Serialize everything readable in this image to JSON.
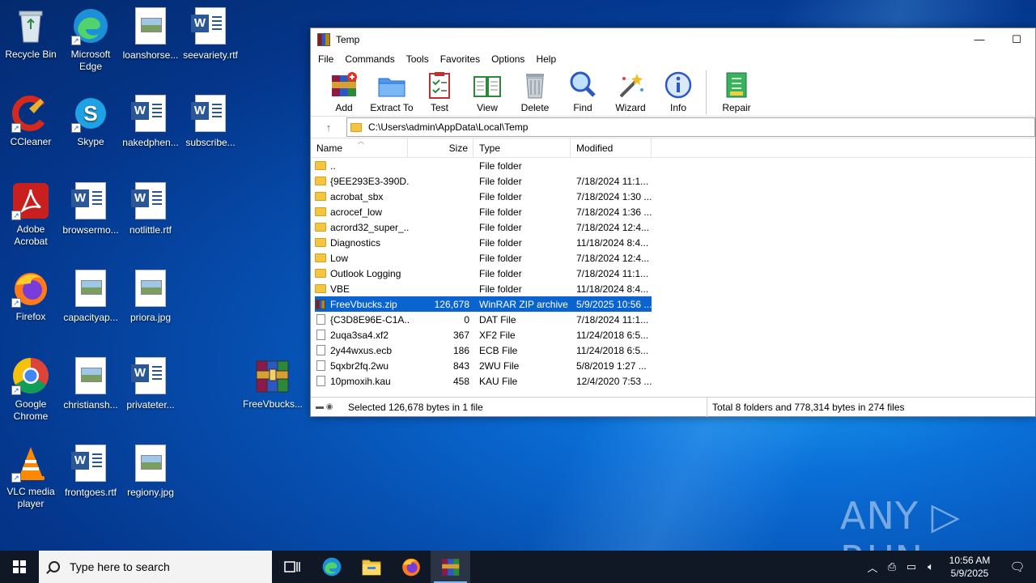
{
  "desktop": {
    "icons": [
      {
        "label": "Recycle Bin"
      },
      {
        "label": "Microsoft Edge"
      },
      {
        "label": "loanshorse..."
      },
      {
        "label": "seevariety.rtf"
      },
      {
        "label": "CCleaner"
      },
      {
        "label": "Skype"
      },
      {
        "label": "nakedphen..."
      },
      {
        "label": "subscribe..."
      },
      {
        "label": "Adobe Acrobat"
      },
      {
        "label": "browsermo..."
      },
      {
        "label": "notlittle.rtf"
      },
      {
        "label": "Firefox"
      },
      {
        "label": "capacityap..."
      },
      {
        "label": "priora.jpg"
      },
      {
        "label": "Google Chrome"
      },
      {
        "label": "christiansh..."
      },
      {
        "label": "privateter..."
      },
      {
        "label": "FreeVbucks..."
      },
      {
        "label": "VLC media player"
      },
      {
        "label": "frontgoes.rtf"
      },
      {
        "label": "regiony.jpg"
      }
    ]
  },
  "window": {
    "title": "Temp",
    "minimize": "—",
    "maximize": "☐",
    "menu": [
      "File",
      "Commands",
      "Tools",
      "Favorites",
      "Options",
      "Help"
    ],
    "toolbar": [
      "Add",
      "Extract To",
      "Test",
      "View",
      "Delete",
      "Find",
      "Wizard",
      "Info",
      "Repair"
    ],
    "address": "C:\\Users\\admin\\AppData\\Local\\Temp",
    "columns": {
      "name": "Name",
      "size": "Size",
      "type": "Type",
      "modified": "Modified"
    },
    "rows": [
      {
        "name": "..",
        "size": "",
        "type": "File folder",
        "modified": "",
        "kind": "folder"
      },
      {
        "name": "{9EE293E3-390D...",
        "size": "",
        "type": "File folder",
        "modified": "7/18/2024 11:1...",
        "kind": "folder"
      },
      {
        "name": "acrobat_sbx",
        "size": "",
        "type": "File folder",
        "modified": "7/18/2024 1:30 ...",
        "kind": "folder"
      },
      {
        "name": "acrocef_low",
        "size": "",
        "type": "File folder",
        "modified": "7/18/2024 1:36 ...",
        "kind": "folder"
      },
      {
        "name": "acrord32_super_...",
        "size": "",
        "type": "File folder",
        "modified": "7/18/2024 12:4...",
        "kind": "folder"
      },
      {
        "name": "Diagnostics",
        "size": "",
        "type": "File folder",
        "modified": "11/18/2024 8:4...",
        "kind": "folder"
      },
      {
        "name": "Low",
        "size": "",
        "type": "File folder",
        "modified": "7/18/2024 12:4...",
        "kind": "folder"
      },
      {
        "name": "Outlook Logging",
        "size": "",
        "type": "File folder",
        "modified": "7/18/2024 11:1...",
        "kind": "folder"
      },
      {
        "name": "VBE",
        "size": "",
        "type": "File folder",
        "modified": "11/18/2024 8:4...",
        "kind": "folder"
      },
      {
        "name": "FreeVbucks.zip",
        "size": "126,678",
        "type": "WinRAR ZIP archive",
        "modified": "5/9/2025 10:56 ...",
        "kind": "zip",
        "selected": true
      },
      {
        "name": "{C3D8E96E-C1A...",
        "size": "0",
        "type": "DAT File",
        "modified": "7/18/2024 11:1...",
        "kind": "file"
      },
      {
        "name": "2uqa3sa4.xf2",
        "size": "367",
        "type": "XF2 File",
        "modified": "11/24/2018 6:5...",
        "kind": "file"
      },
      {
        "name": "2y44wxus.ecb",
        "size": "186",
        "type": "ECB File",
        "modified": "11/24/2018 6:5...",
        "kind": "file"
      },
      {
        "name": "5qxbr2fq.2wu",
        "size": "843",
        "type": "2WU File",
        "modified": "5/8/2019 1:27 ...",
        "kind": "file"
      },
      {
        "name": "10pmoxih.kau",
        "size": "458",
        "type": "KAU File",
        "modified": "12/4/2020 7:53 ...",
        "kind": "file"
      }
    ],
    "status_left": "Selected 126,678 bytes in 1 file",
    "status_right": "Total 8 folders and 778,314 bytes in 274 files"
  },
  "watermark": "ANY ▷ RUN",
  "taskbar": {
    "search_placeholder": "Type here to search",
    "time": "10:56 AM",
    "date": "5/9/2025"
  },
  "colors": {
    "selection": "#0a64d0",
    "taskbar": "#101826"
  }
}
